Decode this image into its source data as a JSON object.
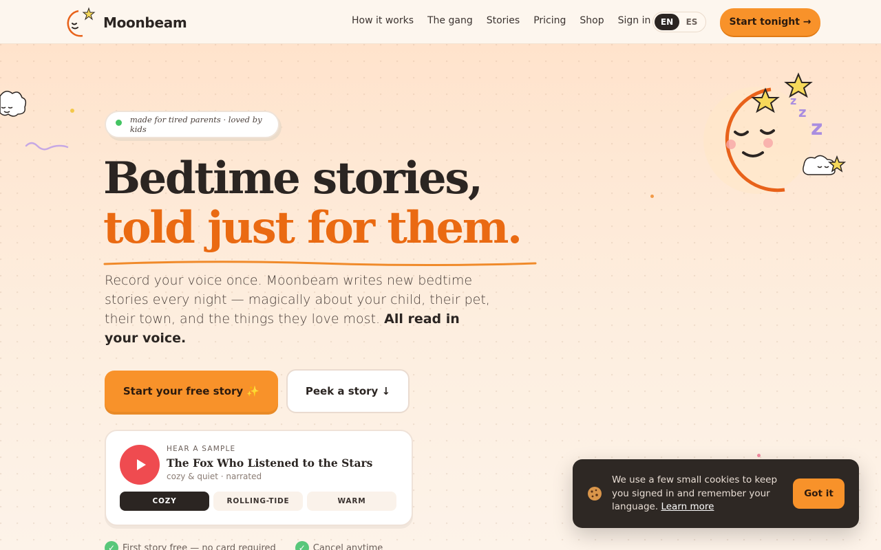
{
  "brand": {
    "name": "Moonbeam"
  },
  "nav": {
    "links": [
      "How it works",
      "The gang",
      "Stories",
      "Pricing",
      "Shop",
      "Sign in"
    ],
    "languages": [
      "EN",
      "ES"
    ],
    "active_language": "EN",
    "cta": "Start tonight →"
  },
  "hero": {
    "pill": "made for tired parents · loved by kids",
    "headline_line1": "Bedtime stories,",
    "headline_line2": "told just for them.",
    "lead": "Record your voice once. Moonbeam writes new bedtime stories every night — magically about your child, their pet, their town, and the things they love most.",
    "lead_emphasis": "All read in your voice.",
    "primary_button": "Start your free story ✨",
    "secondary_button": "Peek a story ↓"
  },
  "sample": {
    "kicker": "HEAR A SAMPLE",
    "title": "The Fox Who Listened to the Stars",
    "meta": "cozy & quiet · narrated",
    "chips": [
      "COZY",
      "ROLLING-TIDE",
      "WARM"
    ],
    "active_chip": "COZY"
  },
  "perks": [
    "First story free — no card required",
    "Cancel anytime"
  ],
  "cookie": {
    "text": "We use a few small cookies to keep you signed in and remember your language.",
    "link": "Learn more",
    "button": "Got it"
  },
  "colors": {
    "accent": "#f8922a",
    "headline_accent": "#ea6a12",
    "dark": "#2b2522",
    "play": "#ef4b50"
  }
}
